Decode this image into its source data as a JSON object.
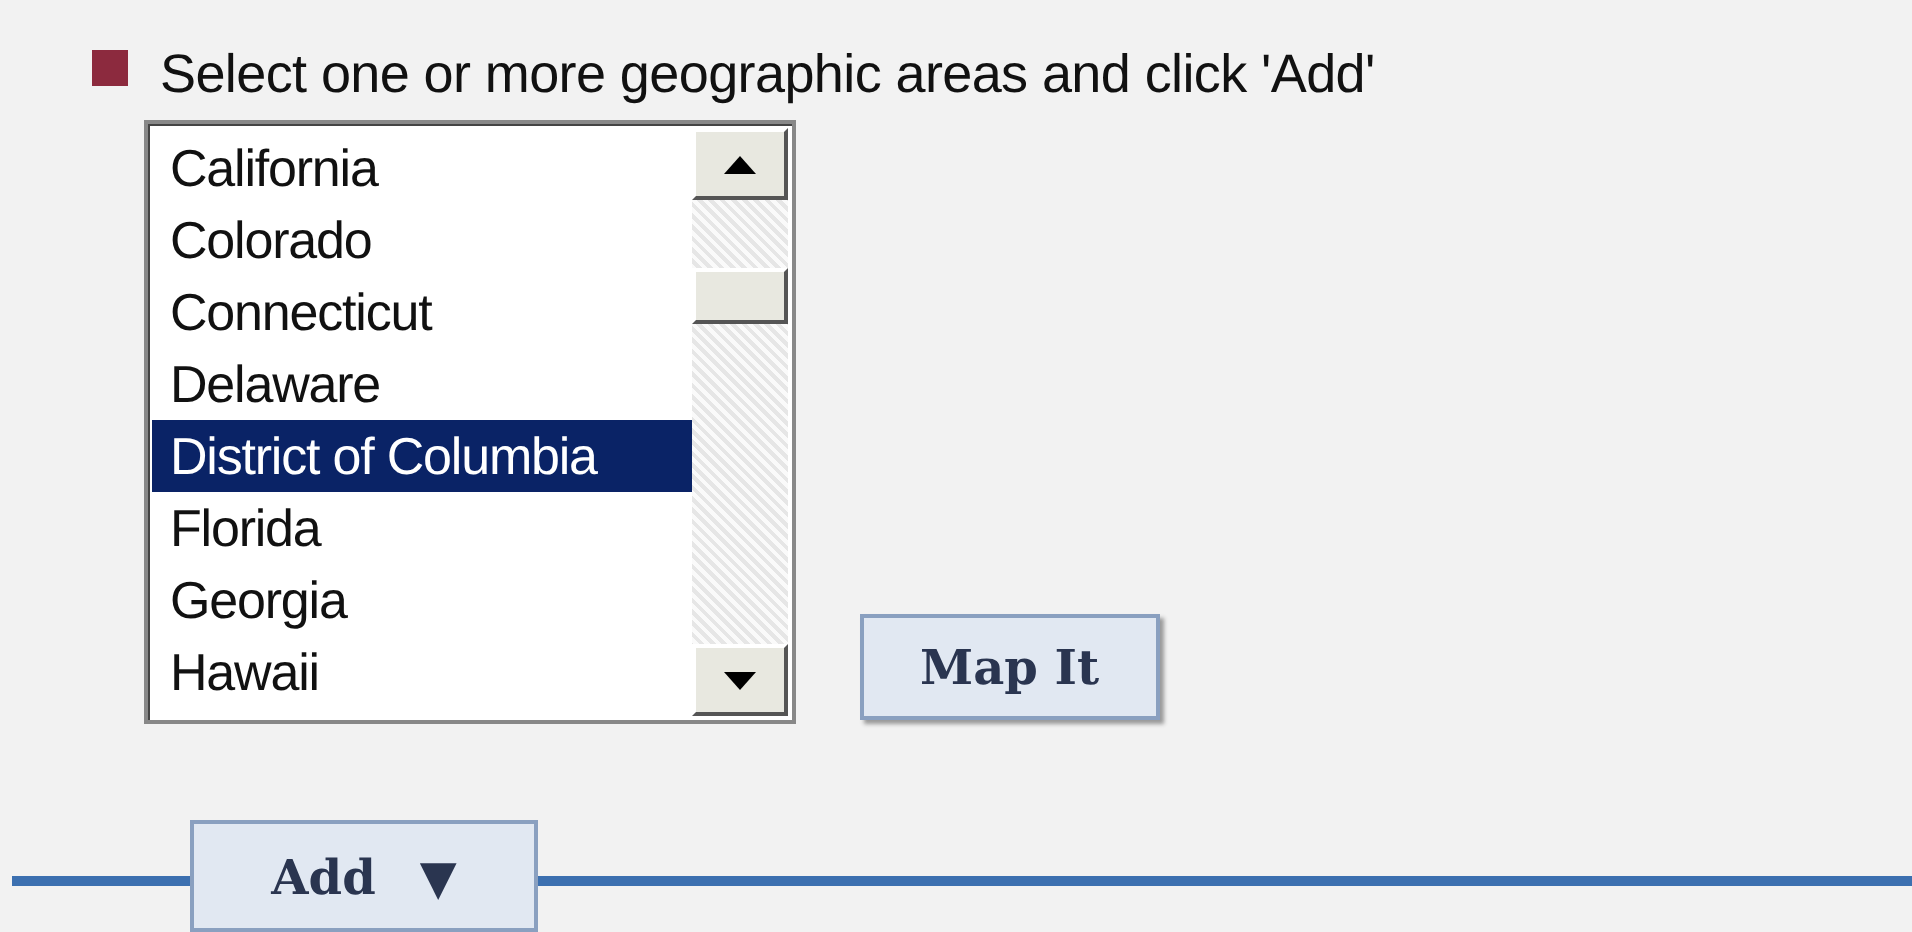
{
  "instruction": "Select one or more geographic areas and click 'Add'",
  "areas": [
    {
      "label": "California",
      "selected": false
    },
    {
      "label": "Colorado",
      "selected": false
    },
    {
      "label": "Connecticut",
      "selected": false
    },
    {
      "label": "Delaware",
      "selected": false
    },
    {
      "label": "District of Columbia",
      "selected": true
    },
    {
      "label": "Florida",
      "selected": false
    },
    {
      "label": "Georgia",
      "selected": false
    },
    {
      "label": "Hawaii",
      "selected": false
    }
  ],
  "map_button": {
    "label": "Map It"
  },
  "add_button": {
    "label": "Add",
    "caret": "▼"
  }
}
